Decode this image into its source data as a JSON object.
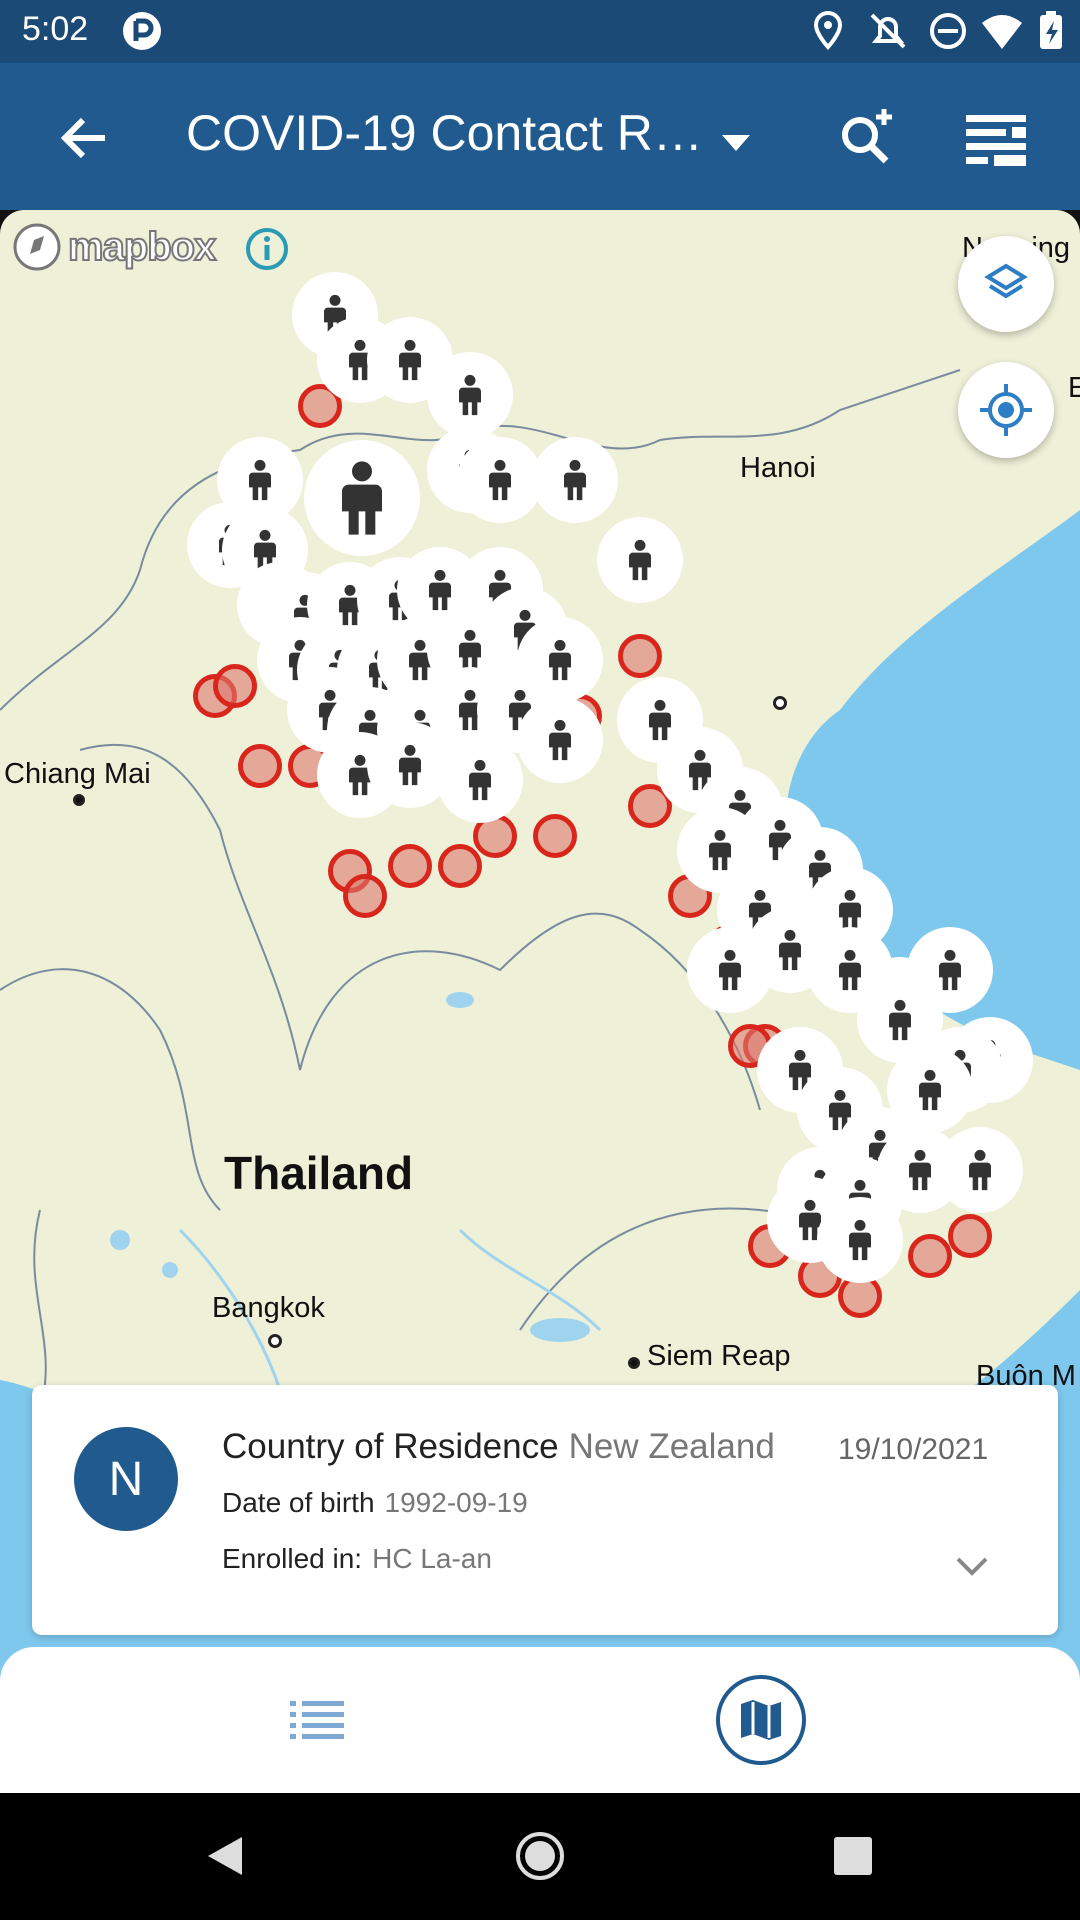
{
  "status_bar": {
    "time": "5:02"
  },
  "app_bar": {
    "title": "COVID-19 Contact R…"
  },
  "map": {
    "attribution": "mapbox",
    "labels": {
      "hanoi": "Hanoi",
      "chiang_mai": "Chiang Mai",
      "thailand": "Thailand",
      "bangkok": "Bangkok",
      "siem_reap": "Siem Reap",
      "buon_ma": "Buôn M",
      "nanning": "Nanning",
      "edge_e": "E"
    }
  },
  "card": {
    "avatar_letter": "N",
    "country_label": "Country of Residence",
    "country_value": "New Zealand",
    "date": "19/10/2021",
    "dob_label": "Date of birth",
    "dob_value": "1992-09-19",
    "enrolled_label": "Enrolled in:",
    "enrolled_value": "HC La-an"
  },
  "colors": {
    "primary": "#215a8e",
    "status_bar": "#1c4a76",
    "marker_ring": "#d9261c",
    "water": "#7ec8ee",
    "land": "#eef0d8"
  },
  "icons": [
    "back-arrow-icon",
    "dropdown-icon",
    "search-add-icon",
    "filter-icon",
    "layers-icon",
    "my-location-icon",
    "directions-icon",
    "list-icon",
    "map-icon",
    "chevron-down-icon",
    "person-icon"
  ]
}
